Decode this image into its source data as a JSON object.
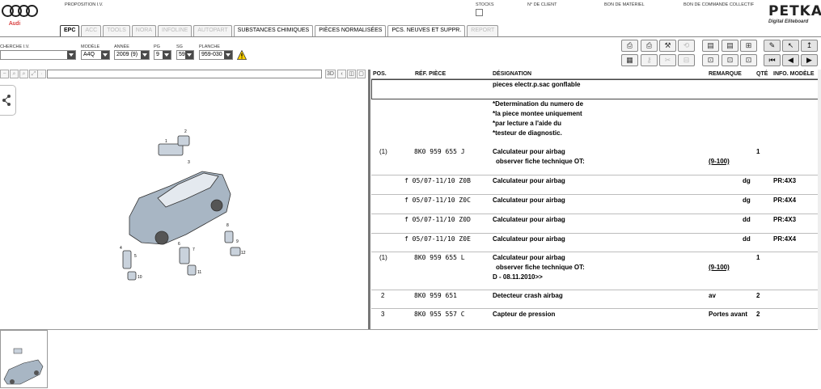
{
  "header": {
    "brand": "Audi",
    "labels": [
      {
        "key": "proposition",
        "text": "PROPOSITION I.V."
      },
      {
        "key": "stocks",
        "text": "STOCKS"
      },
      {
        "key": "client",
        "text": "N° DE CLIENT"
      },
      {
        "key": "materiel",
        "text": "BON DE MATÉRIEL"
      },
      {
        "key": "collectif",
        "text": "BON DE COMMANDE COLLECTIF"
      }
    ],
    "logo_main": "PETKA",
    "logo_sub": "Digital Eliteboard"
  },
  "tabs": [
    {
      "label": "EPC",
      "state": "active"
    },
    {
      "label": "ACC",
      "state": "disabled"
    },
    {
      "label": "TOOLS",
      "state": "disabled"
    },
    {
      "label": "NORA",
      "state": "disabled"
    },
    {
      "label": "INFOLINE",
      "state": "disabled"
    },
    {
      "label": "AUTOPART",
      "state": "disabled"
    },
    {
      "label": "SUBSTANCES CHIMIQUES",
      "state": "enabled"
    },
    {
      "label": "PIÈCES NORMALISÉES",
      "state": "enabled"
    },
    {
      "label": "PCS. NEUVES ET SUPPR.",
      "state": "enabled"
    },
    {
      "label": "REPORT",
      "state": "disabled"
    }
  ],
  "selectors": {
    "cherche": {
      "label": "CHERCHE I.V.",
      "value": ""
    },
    "modele": {
      "label": "MODÈLE",
      "value": "A4Q"
    },
    "annee": {
      "label": "ANNÉE",
      "value": "2009 (9)"
    },
    "pg": {
      "label": "PG",
      "value": "9"
    },
    "sg": {
      "label": "SG",
      "value": "59"
    },
    "planche": {
      "label": "PLANCHE",
      "value": "959-030"
    }
  },
  "table": {
    "headers": {
      "pos": "POS.",
      "ref": "RÉF. PIÈCE",
      "designation": "DÉSIGNATION",
      "remarque": "REMARQUE",
      "qte": "QTÉ",
      "info": "INFO. MODÈLE"
    },
    "title": "pieces electr.p.sac gonflable",
    "note": [
      "*Determination du numero de",
      "*la piece montee uniquement",
      "*par lecture a l'aide du",
      "*testeur de diagnostic."
    ],
    "rows": [
      {
        "pos": "(1)",
        "ref": "8K0  959  655  J",
        "designation": "Calculateur pour airbag",
        "designation2": "observer fiche technique OT:",
        "remarque": "",
        "remarque2": "(9-100)",
        "qte": "1",
        "info": ""
      },
      {
        "pos": "",
        "ref": "f  05/07-11/10  Z0B",
        "designation": "Calculateur pour airbag",
        "remarque": "dg",
        "qte": "",
        "info": "PR:4X3"
      },
      {
        "pos": "",
        "ref": "f  05/07-11/10  Z0C",
        "designation": "Calculateur pour airbag",
        "remarque": "dg",
        "qte": "",
        "info": "PR:4X4"
      },
      {
        "pos": "",
        "ref": "f  05/07-11/10  Z0D",
        "designation": "Calculateur pour airbag",
        "remarque": "dd",
        "qte": "",
        "info": "PR:4X3"
      },
      {
        "pos": "",
        "ref": "f  05/07-11/10  Z0E",
        "designation": "Calculateur pour airbag",
        "remarque": "dd",
        "qte": "",
        "info": "PR:4X4"
      },
      {
        "pos": "(1)",
        "ref": "8K0  959  655  L",
        "designation": "Calculateur pour airbag",
        "designation2": "observer fiche technique OT:",
        "designation3": "D - 08.11.2010>>",
        "remarque": "",
        "remarque2": "(9-100)",
        "qte": "1",
        "info": ""
      },
      {
        "pos": "2",
        "ref": "8K0  959  651",
        "designation": "Detecteur crash airbag",
        "remarque": "av",
        "qte": "2",
        "info": ""
      },
      {
        "pos": "3",
        "ref": "8K0  955  557  C",
        "designation": "Capteur de pression",
        "remarque": "Portes avant",
        "qte": "2",
        "info": ""
      }
    ]
  },
  "illustration": {
    "callouts": [
      "1",
      "2",
      "3",
      "4",
      "5",
      "6",
      "7",
      "8",
      "9",
      "10",
      "11",
      "12"
    ]
  },
  "viewer": {
    "btn_3d": "3D"
  },
  "colors": {
    "accent": "#cc0000",
    "split": "#777777"
  }
}
